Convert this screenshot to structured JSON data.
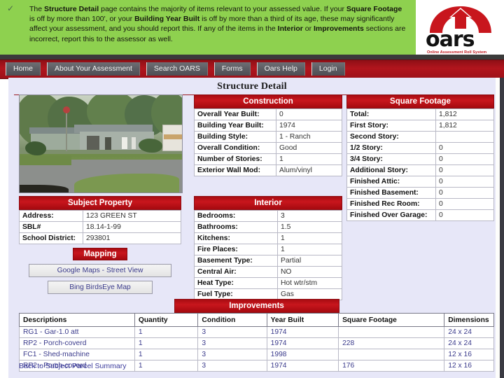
{
  "banner": {
    "check_icon": "checkmark-icon",
    "text_html": "The <b>Structure Detail</b> page contains the majority of items relevant to your assessed value. If your <b>Square Footage</b> is off by more than 100', or your <b>Building Year Built</b> is off by more than a third of its age, these may significantly affect your assessment, and you should report this. If any of the items in the <b>Interior</b> or <b>Improvements</b> sections are incorrect, report this to the assessor as well.",
    "background_color": "#8ed14f"
  },
  "logo": {
    "wordmark": "oars",
    "tagline": "Online Assessment Roll System",
    "arrow_icon": "house-arrow-logo-icon",
    "accent_color": "#c8161d"
  },
  "nav": {
    "background_color": "#a3131b",
    "items": [
      {
        "label": "Home"
      },
      {
        "label": "About Your Assessment"
      },
      {
        "label": "Search OARS"
      },
      {
        "label": "Forms"
      },
      {
        "label": "Oars Help"
      },
      {
        "label": "Login"
      }
    ]
  },
  "page": {
    "title": "Structure Detail",
    "back_link": "Back to Subject Parcel Summary",
    "background_color": "#e7e7f8",
    "header_color": "#c8161d"
  },
  "photo": {
    "alt": "property-photo"
  },
  "construction": {
    "header": "Construction",
    "rows": [
      {
        "label": "Overall Year Built:",
        "value": "0"
      },
      {
        "label": "Building Year Built:",
        "value": "1974"
      },
      {
        "label": "Building Style:",
        "value": "1 - Ranch"
      },
      {
        "label": "Overall Condition:",
        "value": "Good"
      },
      {
        "label": "Number of Stories:",
        "value": "1"
      },
      {
        "label": "Exterior Wall Mod:",
        "value": "Alum/vinyl"
      }
    ]
  },
  "square_footage": {
    "header": "Square Footage",
    "rows": [
      {
        "label": "Total:",
        "value": "1,812"
      },
      {
        "label": "First Story:",
        "value": "1,812"
      },
      {
        "label": "Second Story:",
        "value": ""
      },
      {
        "label": "1/2 Story:",
        "value": "0"
      },
      {
        "label": "3/4 Story:",
        "value": "0"
      },
      {
        "label": "Additional Story:",
        "value": "0"
      },
      {
        "label": "Finished Attic:",
        "value": "0"
      },
      {
        "label": "Finished Basement:",
        "value": "0"
      },
      {
        "label": "Finished Rec Room:",
        "value": "0"
      },
      {
        "label": "Finished Over Garage:",
        "value": "0"
      }
    ]
  },
  "subject_property": {
    "header": "Subject Property",
    "rows": [
      {
        "label": "Address:",
        "value": "123 GREEN ST"
      },
      {
        "label": "SBL#",
        "value": "18.14-1-99"
      },
      {
        "label": "School District:",
        "value": "293801"
      }
    ]
  },
  "interior": {
    "header": "Interior",
    "rows": [
      {
        "label": "Bedrooms:",
        "value": "3"
      },
      {
        "label": "Bathrooms:",
        "value": "1.5"
      },
      {
        "label": "Kitchens:",
        "value": "1"
      },
      {
        "label": "Fire Places:",
        "value": "1"
      },
      {
        "label": "Basement Type:",
        "value": "Partial"
      },
      {
        "label": "Central Air:",
        "value": "NO"
      },
      {
        "label": "Heat Type:",
        "value": "Hot wtr/stm"
      },
      {
        "label": "Fuel Type:",
        "value": "Gas"
      }
    ]
  },
  "mapping": {
    "header": "Mapping",
    "buttons": [
      {
        "label": "Google Maps - Street View"
      },
      {
        "label": "Bing BirdsEye Map"
      }
    ]
  },
  "improvements": {
    "header": "Improvements",
    "columns": [
      "Descriptions",
      "Quantity",
      "Condition",
      "Year Built",
      "Square Footage",
      "Dimensions"
    ],
    "rows": [
      [
        "RG1 - Gar-1.0 att",
        "1",
        "3",
        "1974",
        "",
        "24 x 24"
      ],
      [
        "RP2 - Porch-coverd",
        "1",
        "3",
        "1974",
        "228",
        "24 x 24"
      ],
      [
        "FC1 - Shed-machine",
        "1",
        "3",
        "1998",
        "",
        "12 x 16"
      ],
      [
        "RP2 - Porch-coverd",
        "1",
        "3",
        "1974",
        "176",
        "12 x 16"
      ]
    ]
  }
}
